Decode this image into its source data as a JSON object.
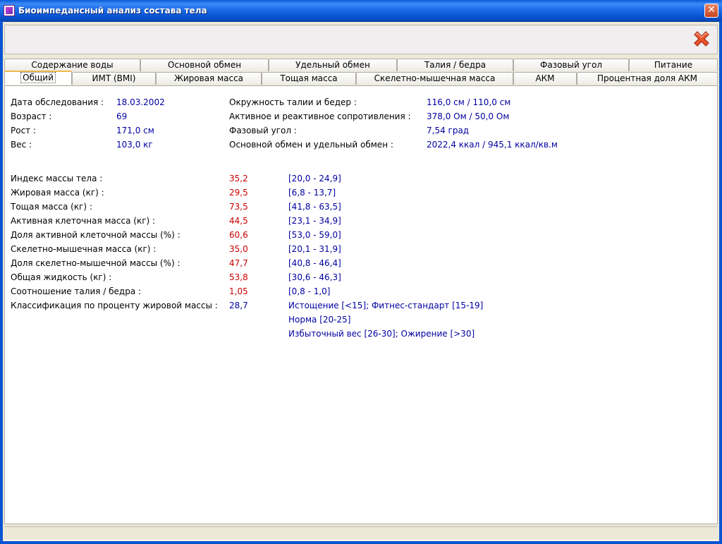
{
  "window": {
    "title": "Биоимпедансный анализ состава тела",
    "close_glyph": "✕"
  },
  "toolbar": {
    "exit_icon": "red-x-icon"
  },
  "tabs_row1": [
    "Содержание воды",
    "Основной обмен",
    "Удельный обмен",
    "Талия / бедра",
    "Фазовый угол",
    "Питание"
  ],
  "tabs_row2": [
    "Общий",
    "ИМТ (BMI)",
    "Жировая масса",
    "Тощая масса",
    "Скелетно-мышечная масса",
    "АКМ",
    "Процентная доля АКМ"
  ],
  "active_tab": "Общий",
  "info_left": [
    {
      "label": "Дата обследования :",
      "value": "18.03.2002"
    },
    {
      "label": "Возраст :",
      "value": "69"
    },
    {
      "label": "Рост :",
      "value": "171,0 см"
    },
    {
      "label": "Вес :",
      "value": "103,0 кг"
    }
  ],
  "info_right": [
    {
      "label": "Окружность талии и бедер :",
      "value": "116,0 см / 110,0 см"
    },
    {
      "label": "Активное и реактивное сопротивления :",
      "value": "378,0 Ом / 50,0 Ом"
    },
    {
      "label": "Фазовый угол :",
      "value": "7,54 град"
    },
    {
      "label": "Основной обмен и удельный обмен :",
      "value": "2022,4 ккал / 945,1 ккал/кв.м"
    }
  ],
  "metrics": [
    {
      "label": "Индекс массы тела :",
      "value": "35,2",
      "range": "[20,0 - 24,9]"
    },
    {
      "label": "Жировая масса (кг) :",
      "value": "29,5",
      "range": "[6,8 - 13,7]"
    },
    {
      "label": "Тощая масса (кг) :",
      "value": "73,5",
      "range": "[41,8 - 63,5]"
    },
    {
      "label": "Активная клеточная масса (кг) :",
      "value": "44,5",
      "range": "[23,1 - 34,9]"
    },
    {
      "label": "Доля активной клеточной массы (%) :",
      "value": "60,6",
      "range": "[53,0 - 59,0]"
    },
    {
      "label": "Скелетно-мышечная масса (кг) :",
      "value": "35,0",
      "range": "[20,1 - 31,9]"
    },
    {
      "label": "Доля скелетно-мышечной массы (%) :",
      "value": "47,7",
      "range": "[40,8 - 46,4]"
    },
    {
      "label": "Общая жидкость (кг) :",
      "value": "53,8",
      "range": "[30,6 - 46,3]"
    },
    {
      "label": "Соотношение талия / бедра :",
      "value": "1,05",
      "range": "[0,8 - 1,0]"
    }
  ],
  "classification": {
    "label": "Классификация по проценту жировой массы :",
    "value": "28,7",
    "lines": [
      "Истощение [<15]; Фитнес-стандарт [15-19]",
      "Норма [20-25]",
      "Избыточный вес [26-30]; Ожирение [>30]"
    ]
  },
  "colors": {
    "label": "#000000",
    "value": "#0000a0",
    "out_of_range": "#cc0000"
  }
}
